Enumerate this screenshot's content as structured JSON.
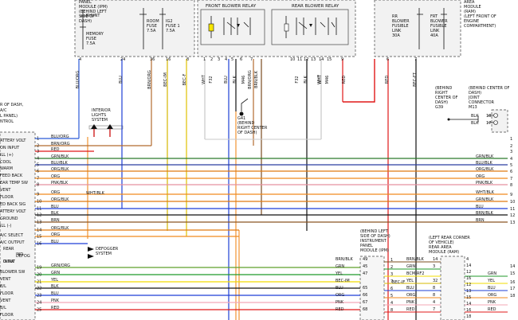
{
  "colors": {
    "BLU": "#1f3fd6",
    "RED": "#e01818",
    "ORG": "#f08a1e",
    "GRN": "#1f9a2a",
    "YEL": "#f0dc00",
    "BLK": "#111111",
    "PNK": "#f3a7b6",
    "WHT": "#c8c8c8",
    "BRN": "#8a5523",
    "BLU/ORG": "#2b5ad8",
    "BRN/ORG": "#b26a2e",
    "BRN/BLK": "#7a4b1e",
    "GRN/BLK": "#2b7a2b",
    "BLU/BLK": "#2a3fa0",
    "ORG/BLK": "#e07a10",
    "PNK/BLK": "#e590a0",
    "WHT/BLK": "#b0b0b0",
    "GRN/ORG": "#5fa02a",
    "GRN/WHT": "#6cbf6c",
    "BEC-F": "#e0c000",
    "BEC-IM": "#d4b800"
  },
  "top_labels": [
    "PANEL",
    "MODULE (IPM)",
    "(BEHIND LEFT",
    "SIDE OF",
    "DASH)",
    "SHUNT",
    "MEMORY",
    "FUSE",
    "7.5A",
    "ROOM",
    "FUSE",
    "7.5A",
    "IG2",
    "FUSE 1",
    "7.5A",
    "FRONT BLOWER RELAY",
    "REAR BLOWER RELAY",
    "RR",
    "BLOWER",
    "FUSIBLE",
    "LINK",
    "30A",
    "FRT",
    "BLOWER",
    "FUSIBLE",
    "LINK",
    "40A",
    "AREA",
    "MODULE",
    "(RAM)",
    "(LEFT FRONT OF",
    "ENGINE",
    "COMPARTMENT)"
  ],
  "top_pins": [
    "4",
    "24",
    "36",
    "16",
    "8",
    "1",
    "2",
    "3",
    "4",
    "5",
    "6",
    "7",
    "10",
    "11",
    "12",
    "13",
    "14",
    "15",
    "9",
    "6",
    "7"
  ],
  "vertical_wire_labels": [
    "BLU/ORG",
    "BLU",
    "BRN/ORG",
    "BEC-IM",
    "BEC-F",
    "WHT",
    "F32",
    "BLU",
    "BLK",
    "M46",
    "BRN/ORG",
    "BRN/BLK",
    "BLK",
    "F32",
    "WHT",
    "M46",
    "WHT",
    "RED",
    "RED",
    "BEC-FT"
  ],
  "panel_labels": [
    "R OF DASH,",
    "A/C",
    "L PANEL)",
    "NTROL",
    "ATTERY VOLT",
    "ON INPUT",
    "ILL (+)",
    "COOL",
    "WARM",
    "FEED BACK",
    "EAR TEMP SW",
    "VENT",
    "FLOOR",
    "ED BACK SIG",
    "ATTERY VOLT",
    "GROUND",
    "ILL (-)",
    "A/C SELECT",
    "A/C OUTPUT",
    "REAR",
    "IND",
    "DEFOG",
    "INPUT",
    "O SW",
    "BLOWER SW",
    "VENT",
    "B/L",
    "FLOOR",
    "VENT",
    "B/L",
    "FLOOR"
  ],
  "left_pin_numbers": [
    "1",
    "2",
    "3",
    "4",
    "5",
    "6",
    "7",
    "8",
    "9",
    "10",
    "11",
    "12",
    "13",
    "14",
    "15",
    "16",
    "19",
    "20",
    "21",
    "22",
    "23",
    "24",
    "25"
  ],
  "wires": [
    {
      "pin": "1",
      "label": "BLU/ORG",
      "color": "BLU/ORG",
      "right_label": ""
    },
    {
      "pin": "2",
      "label": "BRN/ORG",
      "color": "BRN/ORG",
      "right_label": ""
    },
    {
      "pin": "3",
      "label": "RED",
      "color": "RED",
      "right_label": ""
    },
    {
      "pin": "4",
      "label": "GRN/BLK",
      "color": "GRN/BLK",
      "right_label": "GRN/BLK"
    },
    {
      "pin": "5",
      "label": "BLU/BLK",
      "color": "BLU/BLK",
      "right_label": "BLU/BLK"
    },
    {
      "pin": "6",
      "label": "ORG/BLK",
      "color": "ORG/BLK",
      "right_label": "ORG/BLK"
    },
    {
      "pin": "7",
      "label": "ORG",
      "color": "ORG",
      "right_label": "ORG"
    },
    {
      "pin": "8",
      "label": "PNK/BLK",
      "color": "PNK/BLK",
      "right_label": "PNK/BLK"
    },
    {
      "pin": "9",
      "label": "ORG",
      "color": "ORG",
      "right_label": "WHT/BLK"
    },
    {
      "pin": "10",
      "label": "ORG/BLK",
      "color": "ORG/BLK",
      "right_label": "GRN/BLK"
    },
    {
      "pin": "11",
      "label": "BLU",
      "color": "BLU",
      "right_label": "BLU"
    },
    {
      "pin": "12",
      "label": "BLK",
      "color": "BLK",
      "right_label": "BRN/BLK"
    },
    {
      "pin": "13",
      "label": "BRN",
      "color": "BRN",
      "right_label": "BRN"
    },
    {
      "pin": "14",
      "label": "ORG/BLK",
      "color": "ORG/BLK",
      "right_label": ""
    },
    {
      "pin": "15",
      "label": "ORG",
      "color": "ORG",
      "right_label": ""
    },
    {
      "pin": "16",
      "label": "BLU",
      "color": "BLU",
      "right_label": ""
    },
    {
      "pin": "19",
      "label": "GRN/ORG",
      "color": "GRN/ORG",
      "right_label": ""
    },
    {
      "pin": "20",
      "label": "GRN",
      "color": "GRN",
      "right_label": ""
    },
    {
      "pin": "21",
      "label": "YEL",
      "color": "YEL",
      "right_label": ""
    },
    {
      "pin": "22",
      "label": "BLK",
      "color": "BLK",
      "right_label": ""
    },
    {
      "pin": "23",
      "label": "BLU",
      "color": "BLU",
      "right_label": ""
    },
    {
      "pin": "24",
      "label": "PNK",
      "color": "PNK",
      "right_label": ""
    },
    {
      "pin": "25",
      "label": "RED",
      "color": "RED",
      "right_label": ""
    }
  ],
  "right_pin_numbers": [
    "1",
    "2",
    "3",
    "4",
    "5",
    "6",
    "7",
    "8",
    "9",
    "10",
    "11",
    "12",
    "13",
    "14",
    "15",
    "16",
    "17",
    "18"
  ],
  "wht_blk_label": "WHT/BLK",
  "interior_lights_label": [
    "INTERIOR",
    "LIGHTS",
    "SYSTEM"
  ],
  "defogger_label": [
    "DEFOGGER",
    "SYSTEM"
  ],
  "ground_label": [
    "G41",
    "(BEHIND",
    "RIGHT CENTER",
    "OF DASH)"
  ],
  "g39_label": [
    "(BEHIND",
    "RIGHT",
    "CENTER OF",
    "DASH)",
    "G39"
  ],
  "joint_connector_label": [
    "(BEHIND CENTER OF",
    "DASH)",
    "JOINT",
    "CONNECTOR",
    "M13"
  ],
  "joint_pins": [
    {
      "label": "BLK",
      "pin": "18"
    },
    {
      "label": "BLK",
      "pin": "17"
    }
  ],
  "ipm_lower_label": [
    "(BEHIND LEFT",
    "SIDE OF DASH)",
    "INSTRUMENT",
    "PANEL",
    "MODULE (IPM)"
  ],
  "ram_lower_label": [
    "(LEFT REAR CORNER",
    "OF VEHICLE)",
    "REAR AREA",
    "MODULE (RAM)"
  ],
  "ipm_lower_rows": [
    {
      "label": "BRN/BLK",
      "pin": "49"
    },
    {
      "label": "GRN",
      "pin": "45"
    },
    {
      "label": "YEL",
      "pin": "47"
    },
    {
      "label": "BEC-IM",
      "pin": ""
    },
    {
      "label": "BLU",
      "pin": "65"
    },
    {
      "label": "ORG",
      "pin": "66"
    },
    {
      "label": "PNK",
      "pin": "67"
    },
    {
      "label": "RED",
      "pin": "68"
    }
  ],
  "ram_lower_rows": [
    {
      "label": "BRN/BLK",
      "pin": "14"
    },
    {
      "label": "GRN",
      "pin": "3"
    },
    {
      "label": "BCM-RF2",
      "pin": ""
    },
    {
      "label": "YEL",
      "pin": "32"
    },
    {
      "label": "BLU",
      "pin": "8"
    },
    {
      "label": "ORG",
      "pin": "8"
    },
    {
      "label": "PNK",
      "pin": "4"
    },
    {
      "label": "RED",
      "pin": "7"
    }
  ],
  "mid_connector_pins": [
    "1",
    "2",
    "3",
    "7",
    "6",
    "5",
    "4",
    "8"
  ],
  "mid_connector_labels": [
    "BEC-IF"
  ],
  "far_right_pins": [
    "4",
    "14",
    "12",
    "16",
    "12",
    "13",
    "15",
    "14",
    "16",
    "18"
  ],
  "far_right_labels": [
    "GRN",
    "YEL",
    "BLU",
    "ORG",
    "PNK",
    "RED"
  ]
}
